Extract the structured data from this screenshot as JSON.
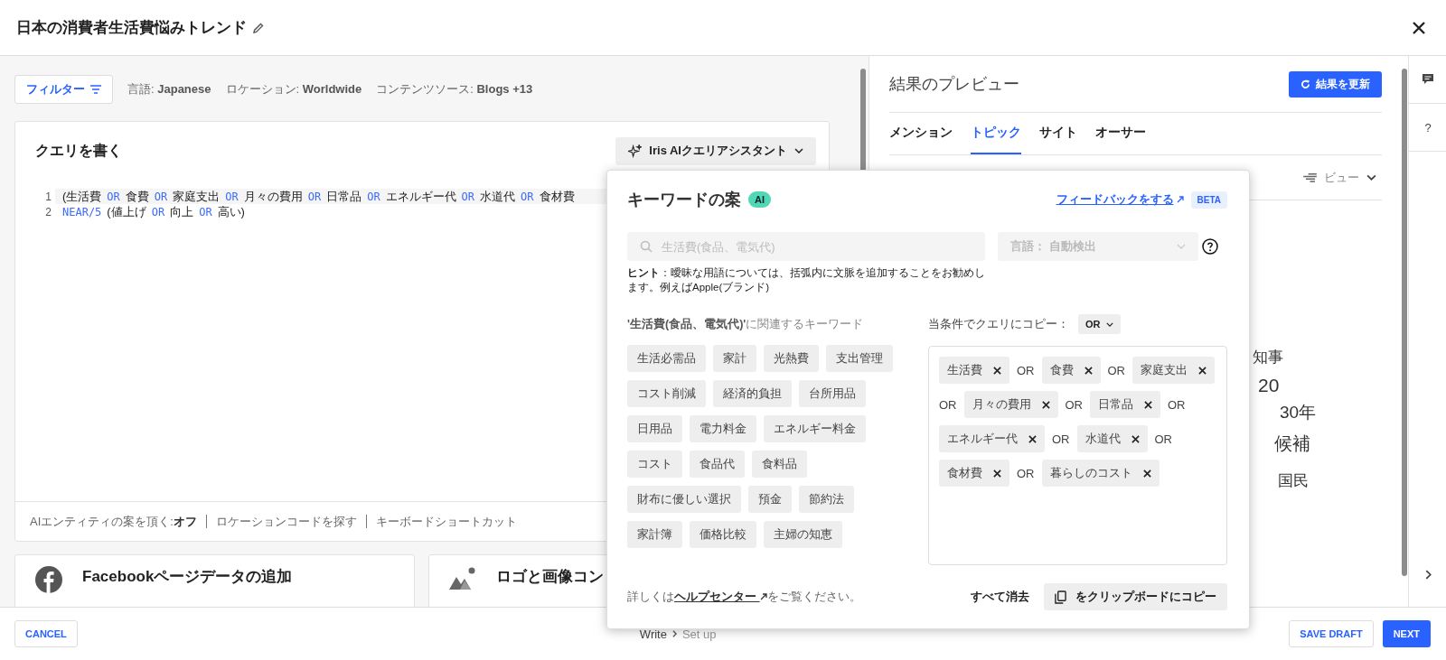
{
  "header": {
    "title": "日本の消費者生活費悩みトレンド"
  },
  "filters": {
    "button": "フィルター",
    "items": [
      {
        "label": "言語:",
        "value": "Japanese"
      },
      {
        "label": "ロケーション:",
        "value": "Worldwide"
      },
      {
        "label": "コンテンツソース:",
        "value": "Blogs +13"
      }
    ]
  },
  "query_editor": {
    "title": "クエリを書く",
    "assistant_button": "Iris AIクエリアシスタント",
    "lines": [
      {
        "number": "1",
        "tokens": [
          {
            "text": "(生活費",
            "kind": "term"
          },
          {
            "text": "OR",
            "kind": "op"
          },
          {
            "text": "食費",
            "kind": "term"
          },
          {
            "text": "OR",
            "kind": "op"
          },
          {
            "text": "家庭支出",
            "kind": "term"
          },
          {
            "text": "OR",
            "kind": "op"
          },
          {
            "text": "月々の費用",
            "kind": "term"
          },
          {
            "text": "OR",
            "kind": "op"
          },
          {
            "text": "日常品",
            "kind": "term"
          },
          {
            "text": "OR",
            "kind": "op"
          },
          {
            "text": "エネルギー代",
            "kind": "term"
          },
          {
            "text": "OR",
            "kind": "op"
          },
          {
            "text": "水道代",
            "kind": "term"
          },
          {
            "text": "OR",
            "kind": "op"
          },
          {
            "text": "食材費",
            "kind": "term"
          }
        ]
      },
      {
        "number": "2",
        "tokens": [
          {
            "text": "NEAR/5",
            "kind": "op"
          },
          {
            "text": "(値上げ",
            "kind": "term"
          },
          {
            "text": "OR",
            "kind": "op"
          },
          {
            "text": "向上",
            "kind": "term"
          },
          {
            "text": "OR",
            "kind": "op"
          },
          {
            "text": "高い)",
            "kind": "term"
          }
        ]
      }
    ],
    "footer": [
      {
        "label": "AIエンティティの案を頂く:",
        "value": "オフ"
      },
      {
        "label": "ロケーションコードを探す"
      },
      {
        "label": "キーボードショートカット"
      }
    ]
  },
  "cards": [
    {
      "title": "Facebookページデータの追加",
      "kind": "facebook"
    },
    {
      "title": "ロゴと画像コン",
      "kind": "image"
    }
  ],
  "preview": {
    "title": "結果のプレビュー",
    "refresh_button": "結果を更新",
    "tabs": [
      {
        "label": "メンション",
        "selected": false
      },
      {
        "label": "トピック",
        "selected": true
      },
      {
        "label": "サイト",
        "selected": false
      },
      {
        "label": "オーサー",
        "selected": false
      }
    ],
    "view": "ビュー",
    "words": [
      "知事",
      "20",
      "30年",
      "候補",
      "国民"
    ]
  },
  "keyword_popup": {
    "title": "キーワードの案",
    "badge": "AI",
    "feedback_link": "フィードバックをする",
    "beta": "BETA",
    "search": {
      "placeholder": "生活費(食品、電気代)"
    },
    "language_select": "言語： 自動検出",
    "hint": "**ヒント**：曖昧な用語については、括弧内に文脈を追加することをお勧めします。例えばApple(ブランド)",
    "related_heading": "**'生活費(食品、電気代)'**に関連するキーワード",
    "suggestions": [
      "生活必需品",
      "家計",
      "光熱費",
      "支出管理",
      "コスト削減",
      "経済的負担",
      "台所用品",
      "日用品",
      "電力料金",
      "エネルギー料金",
      "コスト",
      "食品代",
      "食料品",
      "財布に優しい選択",
      "預金",
      "節約法",
      "家計簿",
      "価格比較",
      "主婦の知恵"
    ],
    "copy_label": "当条件でクエリにコピー：",
    "operator": "OR",
    "selected": [
      {
        "text": "生活費",
        "connector": "OR"
      },
      {
        "text": "食費",
        "connector": "OR"
      },
      {
        "text": "家庭支出",
        "connector": "OR"
      },
      {
        "text": "月々の費用",
        "connector": "OR"
      },
      {
        "text": "日常品",
        "connector": "OR"
      },
      {
        "text": "エネルギー代",
        "connector": "OR"
      },
      {
        "text": "水道代",
        "connector": "OR"
      },
      {
        "text": "食材費",
        "connector": "OR"
      },
      {
        "text": "暮らしのコスト"
      }
    ],
    "help_prefix": "詳しくは",
    "help_link": "ヘルプセンター",
    "help_suffix": "をご覧ください。",
    "clear_all": "すべて消去",
    "copy_button": "をクリップボードにコピー"
  },
  "sidebar": {
    "help": "?"
  },
  "footer": {
    "cancel": "CANCEL",
    "steps": [
      {
        "label": "Write",
        "selected": true
      },
      {
        "label": "Set up",
        "selected": false
      }
    ],
    "save_draft": "SAVE DRAFT",
    "next": "NEXT"
  }
}
